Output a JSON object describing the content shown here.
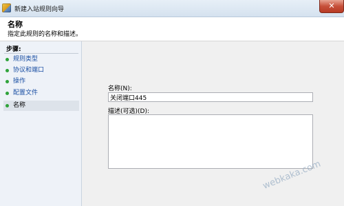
{
  "window": {
    "title": "新建入站规则向导",
    "icon": "firewall-app-icon",
    "close_glyph": "✕"
  },
  "header": {
    "title": "名称",
    "description": "指定此规则的名称和描述。"
  },
  "steps": {
    "heading": "步骤:",
    "items": [
      {
        "label": "规则类型",
        "state": "link"
      },
      {
        "label": "协议和端口",
        "state": "link"
      },
      {
        "label": "操作",
        "state": "link"
      },
      {
        "label": "配置文件",
        "state": "link"
      },
      {
        "label": "名称",
        "state": "current"
      }
    ]
  },
  "form": {
    "name_label": "名称(N):",
    "name_value": "关闭端口445",
    "description_label": "描述(可选)(D):",
    "description_value": ""
  },
  "watermark": "webkaka.com"
}
